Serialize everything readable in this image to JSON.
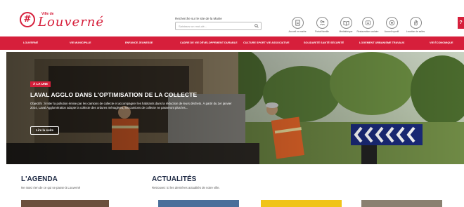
{
  "header": {
    "logo_small": "Ville de",
    "logo_name": "Louverné",
    "logo_mark": "#",
    "search_label": "Recherche sur le site de la Mairie",
    "search_placeholder": "Saisissez un mot-clé...",
    "quick_links": [
      {
        "label": "Accueil en mairie",
        "icon": "document-icon"
      },
      {
        "label": "Portail famille",
        "icon": "family-icon"
      },
      {
        "label": "Médiathèque",
        "icon": "book-icon"
      },
      {
        "label": "Restauration scolaire",
        "icon": "food-icon"
      },
      {
        "label": "Accueil sportif",
        "icon": "ball-icon"
      },
      {
        "label": "Location de salles",
        "icon": "hand-icon"
      }
    ],
    "corner_tab": "?"
  },
  "nav": {
    "items": [
      "LOUVERNÉ",
      "VIE MUNICIPALE",
      "ENFANCE JEUNESSE",
      "CADRE DE VIE DÉVELOPPEMENT DURABLE",
      "CULTURE SPORT VIE ASSOCIATIVE",
      "SOLIDARITÉ SANTÉ SÉCURITÉ",
      "LOGEMENT URBANISME TRAVAUX",
      "VIE ÉCONOMIQUE"
    ]
  },
  "hero": {
    "tag": "À LA UNE",
    "title": "LAVAL AGGLO DANS L'OPTIMISATION DE LA COLLECTE",
    "description": "Objectifs : limiter la pollution émise par les camions de collecte et accompagner les habitants dans la réduction de leurs déchets. À partir du 1er janvier 2024, Laval Agglomération adopte la collecte des ordures ménagères, les camions de collecte ne passeront plus les...",
    "button": "Lire la suite"
  },
  "agenda": {
    "title": "L'AGENDA",
    "subtitle": "Ne ratez rien de ce qui se passe à Louverné"
  },
  "actualites": {
    "title": "ACTUALITÉS",
    "subtitle": "Retrouvez ici les dernières actualités de notre ville."
  },
  "colors": {
    "brand_red": "#d61f3b",
    "navy": "#1f2a44"
  }
}
